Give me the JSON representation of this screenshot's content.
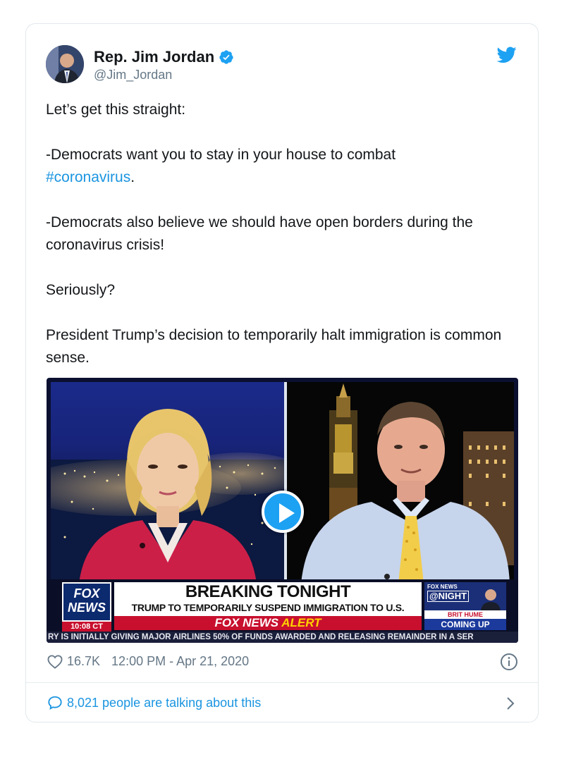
{
  "author": {
    "name": "Rep. Jim Jordan",
    "handle": "@Jim_Jordan"
  },
  "tweet": {
    "lines": [
      "Let’s get this straight:",
      "-Democrats want you to stay in your house to combat",
      "#coronavirus",
      ".",
      "-Democrats also believe we should have open borders during the coronavirus crisis!",
      "Seriously?",
      "President Trump’s decision to temporarily halt immigration is common sense."
    ]
  },
  "video": {
    "logo_top": "FOX",
    "logo_bottom": "NEWS",
    "time": "10:08 CT",
    "headline": "BREAKING TONIGHT",
    "subheadline": "TRUMP TO TEMPORARILY SUSPEND IMMIGRATION TO U.S.",
    "alert_white": "FOX NEWS",
    "alert_yellow": "ALERT",
    "promo_brand": "FOX NEWS",
    "promo_show": "@NIGHT",
    "promo_host": "BRIT HUME",
    "promo_coming": "COMING UP",
    "ticker": "RY IS INITIALLY GIVING MAJOR AIRLINES 50% OF FUNDS AWARDED AND RELEASING REMAINDER IN A SER"
  },
  "meta": {
    "likes": "16.7K",
    "timestamp": "12:00 PM - Apr 21, 2020"
  },
  "conversation": {
    "label": "8,021 people are talking about this"
  },
  "colors": {
    "accent": "#1da1f2",
    "link": "#1b95e0",
    "muted": "#657786",
    "fox_red": "#c8102e"
  }
}
